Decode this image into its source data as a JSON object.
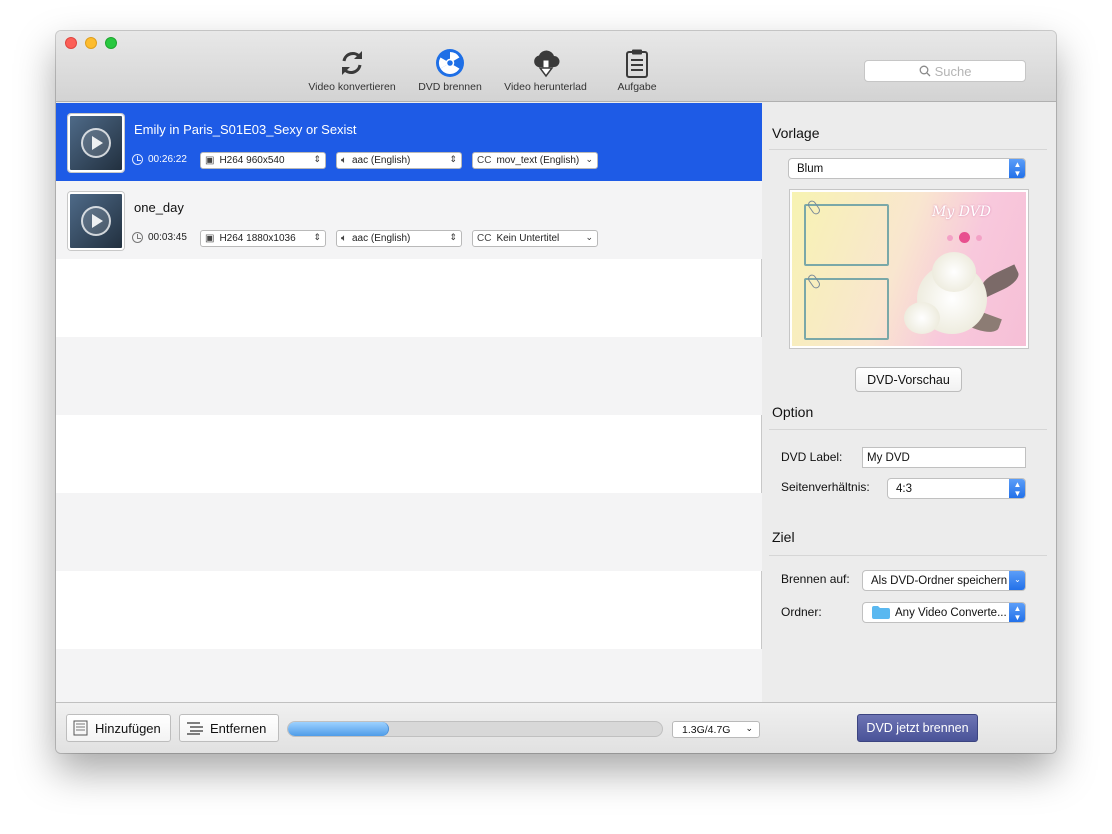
{
  "toolbar": {
    "items": [
      {
        "label": "Video konvertieren",
        "icon": "refresh-icon"
      },
      {
        "label": "DVD brennen",
        "icon": "radiation-icon"
      },
      {
        "label": "Video herunterlad",
        "icon": "cloud-download-icon"
      },
      {
        "label": "Aufgabe",
        "icon": "clipboard-icon"
      }
    ],
    "search_placeholder": "Suche"
  },
  "videos": [
    {
      "title": "Emily in Paris_S01E03_Sexy or Sexist",
      "duration": "00:26:22",
      "video": "H264 960x540",
      "audio": "aac (English)",
      "subtitle_prefix": "CC",
      "subtitle": "mov_text (English)",
      "selected": true
    },
    {
      "title": "one_day",
      "duration": "00:03:45",
      "video": "H264 1880x1036",
      "audio": "aac (English)",
      "subtitle_prefix": "CC",
      "subtitle": "Kein Untertitel",
      "selected": false
    }
  ],
  "sidebar": {
    "vorlage_title": "Vorlage",
    "template_select": "Blum",
    "template_preview_text": "My DVD",
    "preview_button": "DVD-Vorschau",
    "option_title": "Option",
    "dvd_label_label": "DVD Label:",
    "dvd_label_value": "My DVD",
    "aspect_label": "Seitenverhältnis:",
    "aspect_value": "4:3",
    "ziel_title": "Ziel",
    "burn_to_label": "Brennen auf:",
    "burn_to_value": "Als DVD-Ordner speichern",
    "folder_label": "Ordner:",
    "folder_value": "Any Video Converte..."
  },
  "bottom": {
    "add_button": "Hinzufügen",
    "remove_button": "Entfernen",
    "progress": 0.27,
    "size": "1.3G/4.7G",
    "burn_button": "DVD jetzt brennen"
  },
  "colors": {
    "selection": "#1e5be6",
    "accent_blue": "#1f6ee8",
    "burn_button": "#4a5398"
  }
}
